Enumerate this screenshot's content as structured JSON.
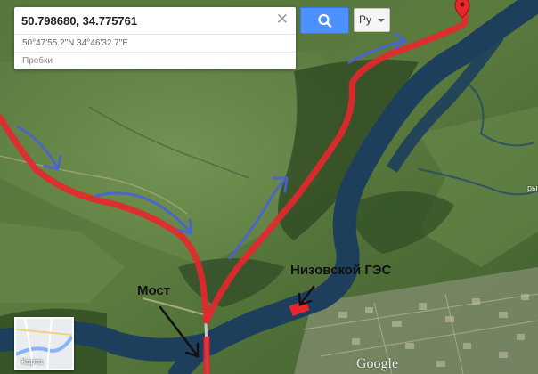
{
  "search": {
    "value": "50.798680, 34.775761",
    "clear_icon": "close-icon",
    "button_icon": "search-icon",
    "suggestions": [
      "50°47'55.2\"N 34°46'32.7\"E",
      "Пробки"
    ]
  },
  "language": {
    "selected": "Ру"
  },
  "map": {
    "type": "satellite",
    "labels": {
      "bridge": "Мост",
      "dam": "Низовской ГЭС"
    },
    "minimap_label": "Карта",
    "watermark": "Google",
    "edge_label": "ры",
    "colors": {
      "route": "#e8262d",
      "arrows": "#4a63d4",
      "river": "#1d3f5c",
      "pin": "#e8262d",
      "search_button": "#4d90fe"
    }
  }
}
